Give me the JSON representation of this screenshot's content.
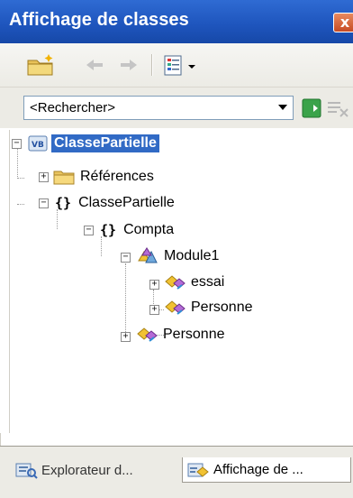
{
  "window": {
    "title": "Affichage de classes",
    "close_label": "x"
  },
  "search": {
    "placeholder": "<Rechercher>"
  },
  "tree": {
    "root": "ClassePartielle",
    "references": "Références",
    "namespace": "ClassePartielle",
    "sub_namespace": "Compta",
    "module": "Module1",
    "module_children": [
      "essai",
      "Personne"
    ],
    "class": "Personne",
    "braces": "{}"
  },
  "tabs": [
    {
      "label": "Explorateur d..."
    },
    {
      "label": "Affichage de ..."
    }
  ],
  "colors": {
    "titlebar": "#2258c4",
    "selection": "#316ac5"
  }
}
